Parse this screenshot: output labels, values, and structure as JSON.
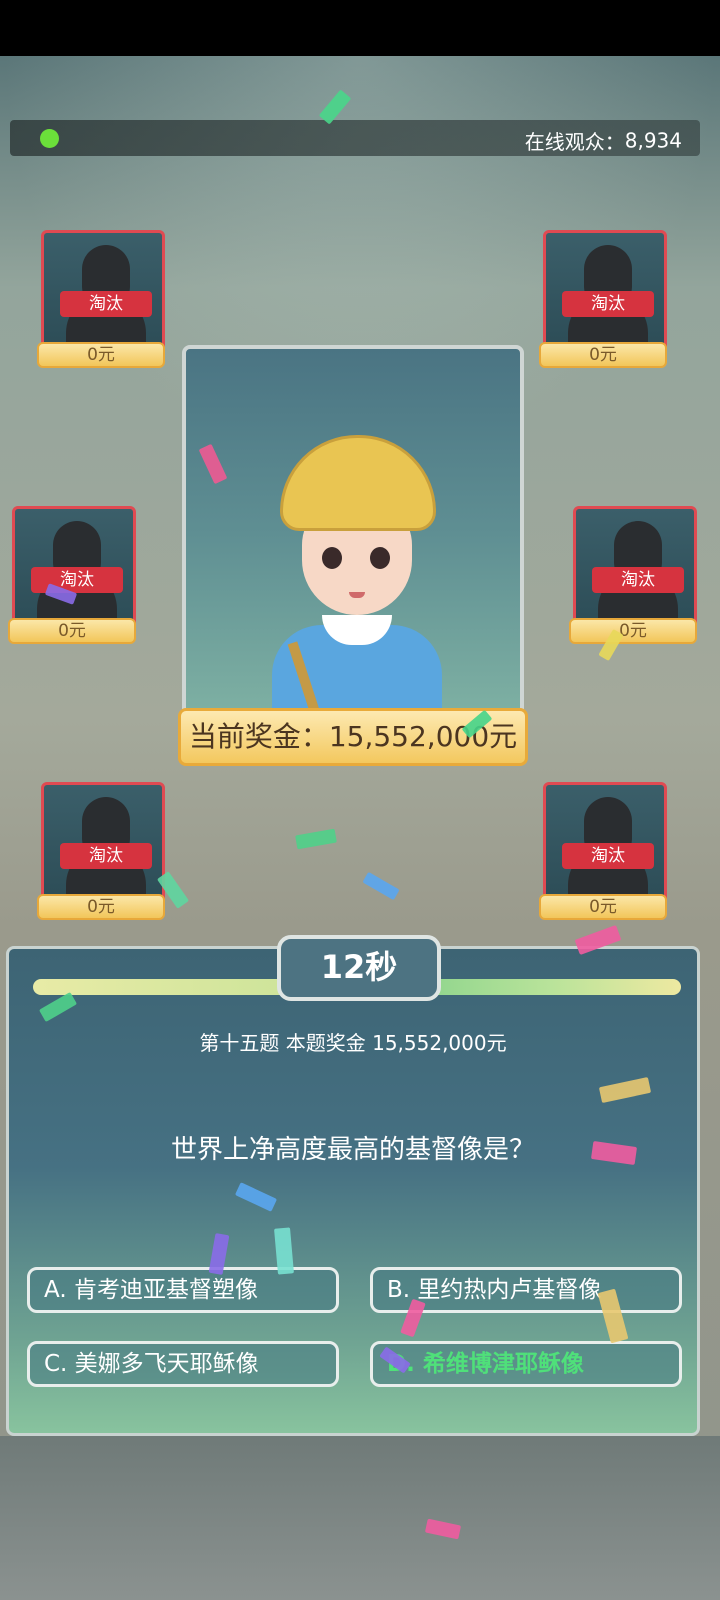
{
  "hud": {
    "viewers_label": "在线观众：",
    "viewers_count": "8,934"
  },
  "players": [
    {
      "status": "淘汰",
      "prize": "0元"
    },
    {
      "status": "淘汰",
      "prize": "0元"
    },
    {
      "status": "淘汰",
      "prize": "0元"
    },
    {
      "status": "淘汰",
      "prize": "0元"
    },
    {
      "status": "淘汰",
      "prize": "0元"
    },
    {
      "status": "淘汰",
      "prize": "0元"
    }
  ],
  "current_prize": "当前奖金：15,552,000元",
  "quiz": {
    "timer": "12秒",
    "question_number": "第十五题 本题奖金 15,552,000元",
    "question": "世界上净高度最高的基督像是？",
    "answers": [
      {
        "label": "A. 肯考迪亚基督塑像"
      },
      {
        "label": "B. 里约热内卢基督像"
      },
      {
        "label": "C. 美娜多飞天耶稣像"
      },
      {
        "label": "D. 希维博津耶稣像"
      }
    ]
  },
  "colors": {
    "live_dot": "#6be03a",
    "eliminated": "#d6333f",
    "correct_answer": "#4fe07a"
  }
}
